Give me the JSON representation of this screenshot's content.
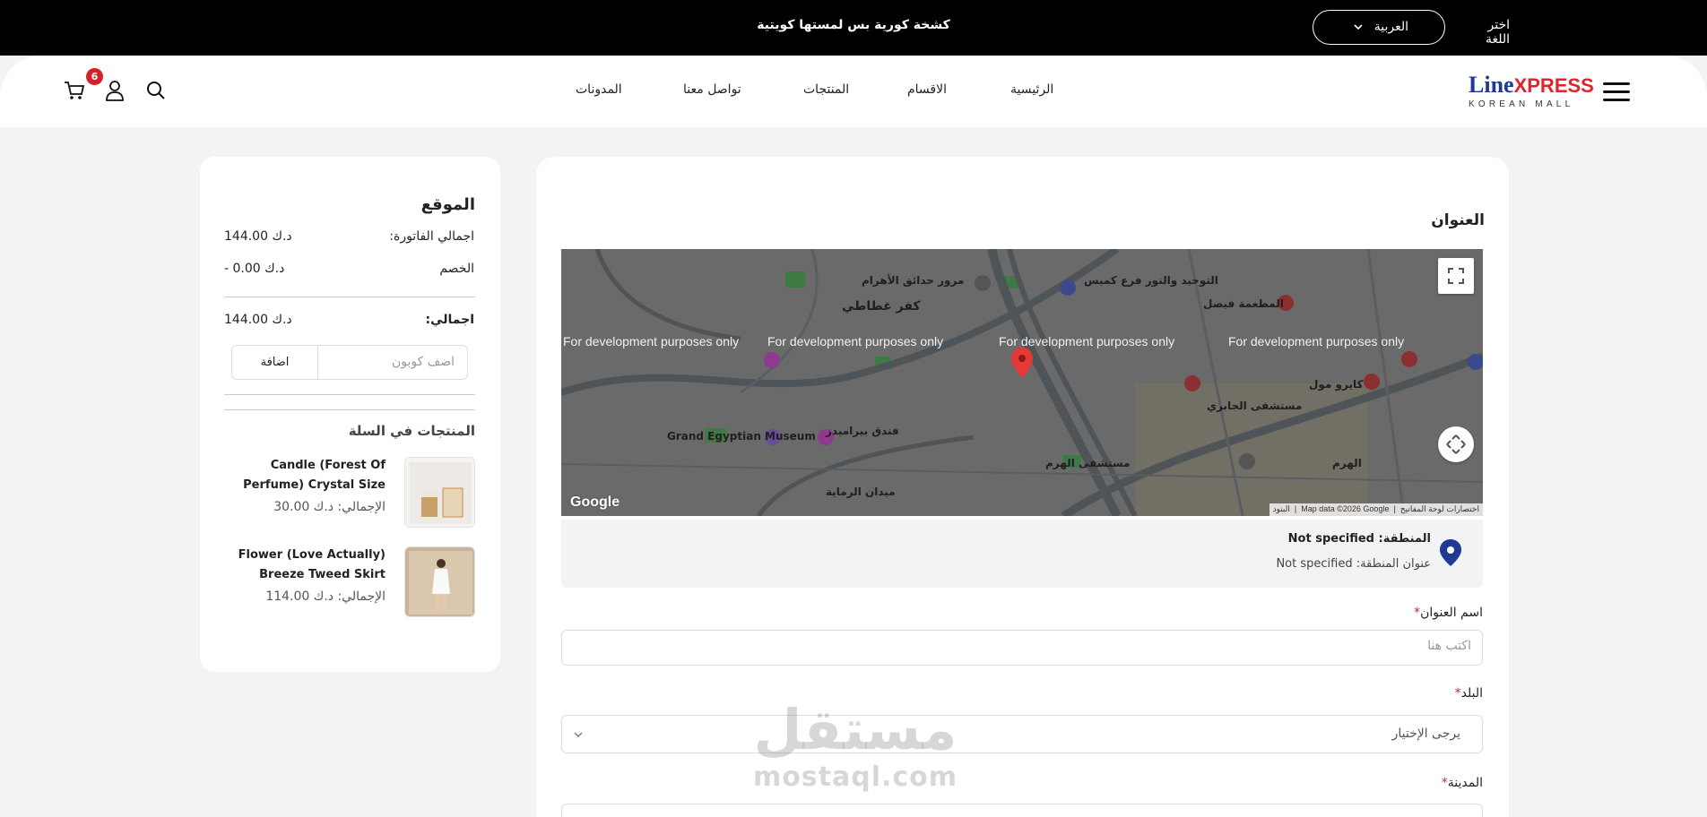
{
  "topbar": {
    "promo": "كشخة كورية بس لمستها كويتية",
    "language_label": "اختر اللغة",
    "language_value": "العربية"
  },
  "header": {
    "logo_main": "Line",
    "logo_accent": "XPRESS",
    "logo_sub": "KOREAN MALL",
    "nav": [
      "الرئيسية",
      "الاقسام",
      "المنتجات",
      "تواصل معنا",
      "المدونات"
    ],
    "cart_count": "6"
  },
  "address_form": {
    "title": "العنوان",
    "map": {
      "dev_notice": "For development purposes only",
      "labels": [
        "كفر غطاطي",
        "Grand Egyptian Museum",
        "مرور حدائق الأهرام",
        "التوحيد والنور فرع كمبس",
        "المطعمة فيصل",
        "كايرو مول",
        "مستشفى الجابري",
        "مستشفى الهرم",
        "الهرم",
        "فندق بيراميدز",
        "ميدان الرماية"
      ],
      "google": "Google",
      "attribution": [
        "اختصارات لوحة المفاتيح",
        "Map data ©2026 Google",
        "البنود"
      ]
    },
    "region_name": "المنطقة: Not specified",
    "region_address": "عنوان المنطقة: Not specified",
    "address_name_label": "اسم العنوان",
    "address_name_placeholder": "اكتب هنا",
    "country_label": "البلد",
    "country_value": "يرجى الإختيار",
    "city_label": "المدينة"
  },
  "summary": {
    "title": "الموقع",
    "invoice_total_label": "اجمالي الفاتورة:",
    "invoice_total_value": "144.00 د.ك",
    "discount_label": "الخصم",
    "discount_value": "- 0.00 د.ك",
    "total_label": "اجمالي:",
    "total_value": "144.00 د.ك",
    "coupon_placeholder": "اضف كوبون",
    "coupon_button": "اضافة",
    "products_title": "المنتجات في السلة",
    "products": [
      {
        "name": "Candle (Forest Of Perfume) Crystal Size",
        "total": "الإجمالي: د.ك 30.00"
      },
      {
        "name": "Flower (Love Actually) Breeze Tweed Skirt",
        "total": "الإجمالي: د.ك 114.00"
      }
    ]
  },
  "watermark": {
    "ar": "مستقل",
    "en": "mostaql.com"
  },
  "colors": {
    "accent": "#d4222a",
    "brand_blue": "#1f3a93",
    "pin": "#e53935"
  }
}
